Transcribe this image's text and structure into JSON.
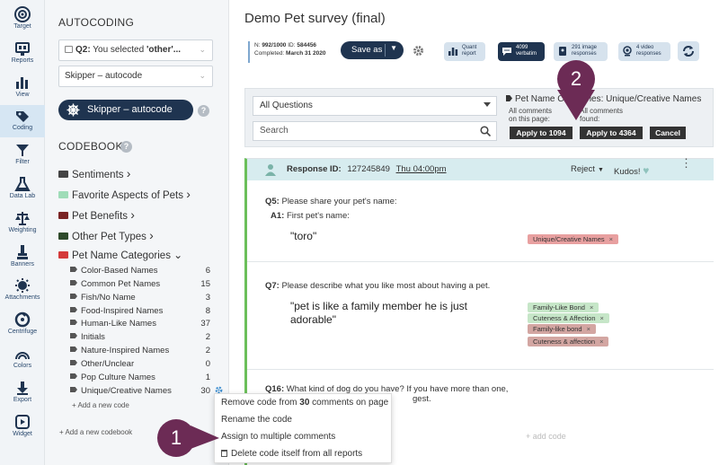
{
  "nav": [
    {
      "label": "Target",
      "icon": "target-icon"
    },
    {
      "label": "Reports",
      "icon": "reports-icon"
    },
    {
      "label": "View",
      "icon": "view-icon"
    },
    {
      "label": "Coding",
      "icon": "coding-icon"
    },
    {
      "label": "Filter",
      "icon": "filter-icon"
    },
    {
      "label": "Data Lab",
      "icon": "data-lab-icon"
    },
    {
      "label": "Weighting",
      "icon": "weighting-icon"
    },
    {
      "label": "Banners",
      "icon": "banners-icon"
    },
    {
      "label": "Attachments",
      "icon": "attachments-icon"
    },
    {
      "label": "Centrifuge",
      "icon": "centrifuge-icon"
    },
    {
      "label": "Colors",
      "icon": "colors-icon"
    },
    {
      "label": "Export",
      "icon": "export-icon"
    },
    {
      "label": "Widget",
      "icon": "widget-icon"
    }
  ],
  "panel": {
    "title": "AUTOCODING",
    "question_select": "Q2: You selected 'other'...",
    "q_prefix": "Q2:",
    "q_rest": " You selected ",
    "q_bold": "'other'...",
    "skipper_select": "Skipper – autocode",
    "skipper_pill": "Skipper – autocode",
    "codebooks_title": "CODEBOOKS",
    "codebooks": [
      {
        "label": "Sentiments",
        "color": "#444444",
        "chevron": "›"
      },
      {
        "label": "Favorite Aspects of Pets",
        "color": "#9fdcb8",
        "chevron": "›"
      },
      {
        "label": "Pet Benefits",
        "color": "#7a2424",
        "chevron": "›"
      },
      {
        "label": "Other Pet Types",
        "color": "#2e4a2a",
        "chevron": "›"
      },
      {
        "label": "Pet Name Categories",
        "color": "#d43a3a",
        "chevron": "⌄"
      }
    ],
    "sub_codes": [
      {
        "label": "Color-Based Names",
        "count": "6"
      },
      {
        "label": "Common Pet Names",
        "count": "15"
      },
      {
        "label": "Fish/No Name",
        "count": "3"
      },
      {
        "label": "Food-Inspired Names",
        "count": "8"
      },
      {
        "label": "Human-Like Names",
        "count": "37"
      },
      {
        "label": "Initials",
        "count": "2"
      },
      {
        "label": "Nature-Inspired Names",
        "count": "2"
      },
      {
        "label": "Other/Unclear",
        "count": "0"
      },
      {
        "label": "Pop Culture Names",
        "count": "1"
      },
      {
        "label": "Unique/Creative Names",
        "count": "30"
      }
    ],
    "add_code": "Add a new code",
    "add_codebook": "Add a new codebook"
  },
  "context_menu": [
    {
      "pre": "Remove code from ",
      "bold": "30",
      "post": " comments on page"
    },
    {
      "pre": "Rename the code",
      "bold": "",
      "post": ""
    },
    {
      "pre": "Assign to multiple comments",
      "bold": "",
      "post": ""
    },
    {
      "pre": "Delete code itself from all reports",
      "bold": "",
      "post": ""
    }
  ],
  "badges": {
    "one": "1",
    "two": "2"
  },
  "header": {
    "title": "Demo Pet survey (final)",
    "meta_line1_a": "N: ",
    "meta_n": "992/1000",
    "meta_line1_b": " ID: ",
    "meta_id": "584456",
    "meta_line2_a": "Completed: ",
    "meta_completed": "March 31 2020",
    "save_as": "Save as",
    "buttons": [
      {
        "line1": "Quant",
        "line2": "report",
        "icon": "quant-report-icon"
      },
      {
        "line1": "4099",
        "line2": "verbatim",
        "icon": "verbatim-icon"
      },
      {
        "line1": "291 image",
        "line2": "responses",
        "icon": "image-responses-icon"
      },
      {
        "line1": "4 video",
        "line2": "responses",
        "icon": "video-responses-icon"
      }
    ]
  },
  "filter": {
    "question_select": "All Questions",
    "search_placeholder": "Search",
    "pet_name": "Pet Name Categories: Unique/Creative Names",
    "page_label_1": "All comments",
    "page_label_2": "on this page:",
    "found_label_1": "All comments",
    "found_label_2": "found:",
    "apply_page": "Apply to 1094",
    "apply_found": "Apply to 4364",
    "cancel": "Cancel"
  },
  "response": {
    "id_label": "Response ID:",
    "id_value": "127245849",
    "time": "Thu 04:00pm",
    "reject": "Reject",
    "kudos": "Kudos!",
    "q5": "Q5:",
    "q5_text": " Please share your pet's name:",
    "a1": "A1:",
    "a1_text": " First pet's name:",
    "answer1": "\"toro\"",
    "q7": "Q7:",
    "q7_text": " Please describe what you like most about having a pet.",
    "answer2": "\"pet is like a family member he is just adorable\"",
    "q16": "Q16:",
    "q16_text": " What kind of dog do you have? If you have more than one,",
    "q16_text2": "gest.",
    "add_code": "+ add code",
    "chips1": [
      {
        "label": "Unique/Creative Names",
        "color": "#e8a0a0"
      }
    ],
    "chips2": [
      {
        "label": "Family-Like Bond",
        "color": "#c6e6c8"
      },
      {
        "label": "Cuteness & Affection",
        "color": "#c6e6c8"
      },
      {
        "label": "Family-like bond",
        "color": "#d3a6a2"
      },
      {
        "label": "Cuteness & affection",
        "color": "#d3a6a2"
      }
    ]
  }
}
